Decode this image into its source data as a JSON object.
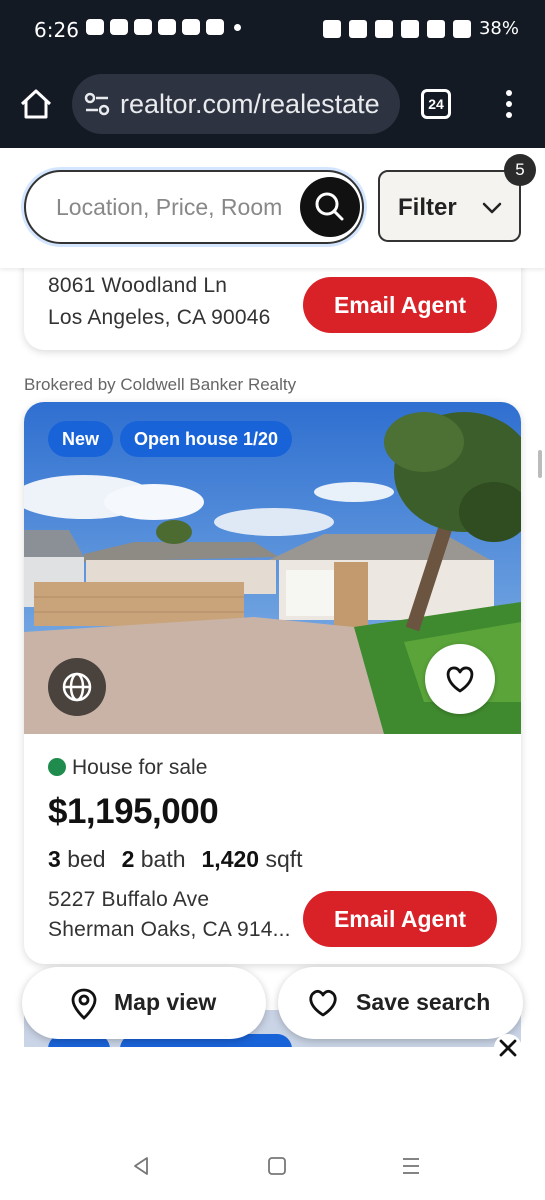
{
  "status_bar": {
    "time": "6:26",
    "battery": "38%"
  },
  "browser": {
    "url": "realtor.com/realestate",
    "tab_count": "24"
  },
  "search": {
    "placeholder": "Location, Price, Room",
    "filter_label": "Filter",
    "filter_badge": "5"
  },
  "listings": [
    {
      "address_line1": "8061 Woodland Ln",
      "address_line2": "Los Angeles, CA 90046",
      "email_label": "Email Agent"
    },
    {
      "broker": "Brokered by Coldwell Banker Realty",
      "badge_new": "New",
      "badge_open_house": "Open house 1/20",
      "status": "House for sale",
      "status_color": "#1f8c4e",
      "price": "$1,195,000",
      "beds_value": "3",
      "beds_label": "bed",
      "baths_value": "2",
      "baths_label": "bath",
      "sqft_value": "1,420",
      "sqft_label": "sqft",
      "address_line1": "5227 Buffalo Ave",
      "address_line2": "Sherman Oaks, CA 914...",
      "email_label": "Email Agent"
    }
  ],
  "floating": {
    "map_view": "Map view",
    "save_search": "Save search"
  },
  "colors": {
    "accent_red": "#d92228",
    "badge_blue": "#1963d9"
  }
}
